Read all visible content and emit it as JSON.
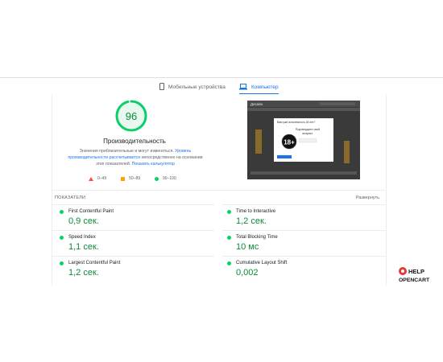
{
  "tabs": {
    "mobile": "Мобильные устройства",
    "desktop": "Компьютер",
    "active": "desktop"
  },
  "performance": {
    "score": "96",
    "score_fraction": 0.96,
    "title": "Производительность",
    "desc_text": "Значения приблизительные и могут изменяться.",
    "desc_link1": "Уровень производительности рассчитывается",
    "desc_text2": "непосредственно на основании этих показателей.",
    "desc_link2": "Показать калькулятор",
    "legend": {
      "bad": "0–49",
      "average": "50–89",
      "good": "90–100"
    }
  },
  "screenshot": {
    "brand": "Дизайн",
    "dialog_question": "Вам уже исполнилось 18 лет?",
    "dialog_line1": "Подтвердите свой",
    "dialog_line2": "возраст",
    "badge": "18+"
  },
  "metrics": {
    "header": "ПОКАЗАТЕЛИ",
    "expand": "Развернуть",
    "items": [
      {
        "name": "First Contentful Paint",
        "value": "0,9 сек."
      },
      {
        "name": "Time to Interactive",
        "value": "1,2 сек."
      },
      {
        "name": "Speed Index",
        "value": "1,1 сек."
      },
      {
        "name": "Total Blocking Time",
        "value": "10 мс"
      },
      {
        "name": "Largest Contentful Paint",
        "value": "1,2 сек."
      },
      {
        "name": "Cumulative Layout Shift",
        "value": "0,002"
      }
    ]
  },
  "watermark": {
    "line1": "HELP",
    "line2": "OPENCART"
  },
  "colors": {
    "good": "#0cce6b",
    "good_text": "#0c8a3a",
    "average": "#ffa400",
    "bad": "#ff4e42",
    "link": "#1a73e8"
  }
}
